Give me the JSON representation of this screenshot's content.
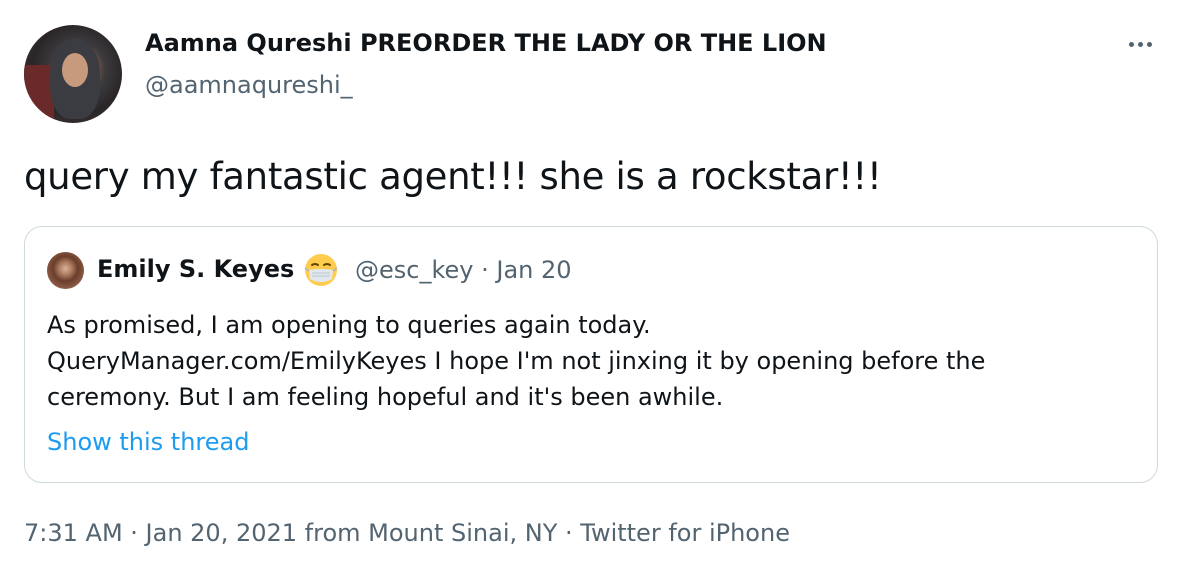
{
  "author": {
    "display_name": "Aamna Qureshi PREORDER THE LADY OR THE LION",
    "handle": "@aamnaqureshi_"
  },
  "more_icon": "ellipsis-horizontal-icon",
  "tweet": {
    "text": "query my fantastic agent!!! she is a rockstar!!!"
  },
  "quoted_tweet": {
    "display_name": "Emily S. Keyes",
    "emoji_icon": "face-with-medical-mask-icon",
    "meta": "@esc_key · Jan 20",
    "body_lines": [
      "As promised, I am opening to queries again today.",
      "QueryManager.com/EmilyKeyes I hope I'm not jinxing it by opening before the",
      "ceremony. But I am feeling hopeful and it's been awhile."
    ],
    "show_thread": "Show this thread"
  },
  "footer": {
    "time_date": "7:31 AM · Jan 20, 2021 from Mount Sinai, NY",
    "separator": " · ",
    "source": "Twitter for iPhone"
  },
  "colors": {
    "text": "#0f1419",
    "secondary": "#536471",
    "link": "#1d9bf0",
    "border": "#cfd9de"
  }
}
